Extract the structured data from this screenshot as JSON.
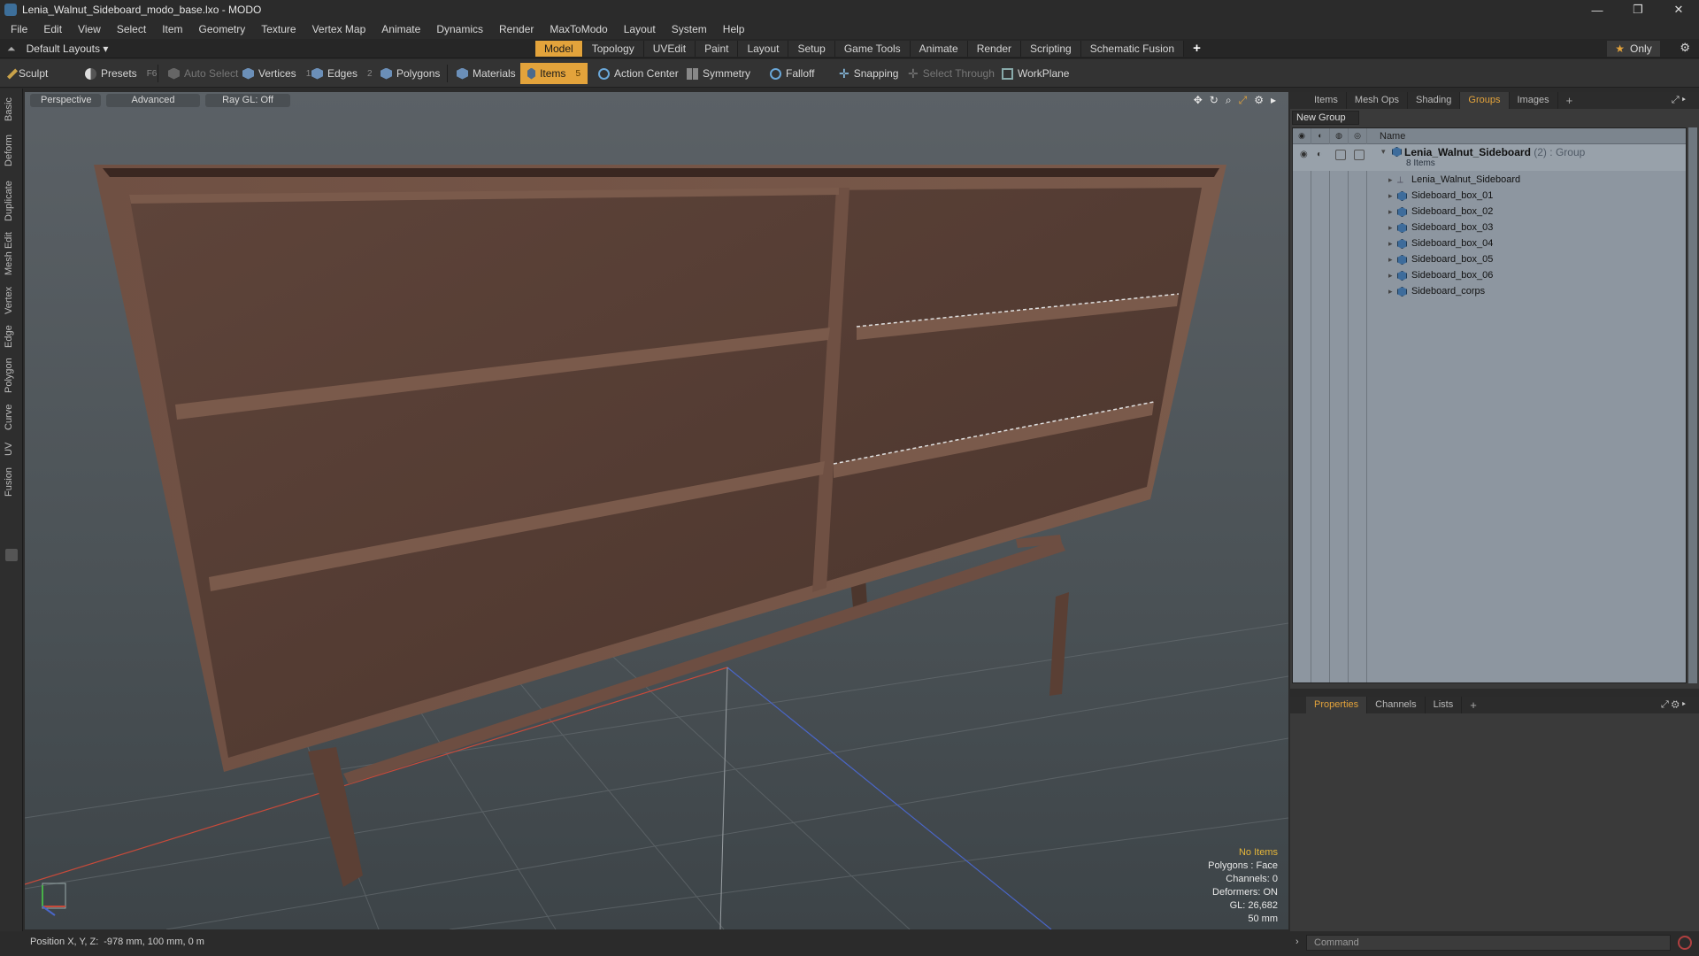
{
  "window": {
    "title": "Lenia_Walnut_Sideboard_modo_base.lxo - MODO",
    "minimize": "—",
    "restore": "❐",
    "close": "✕"
  },
  "menu": [
    "File",
    "Edit",
    "View",
    "Select",
    "Item",
    "Geometry",
    "Texture",
    "Vertex Map",
    "Animate",
    "Dynamics",
    "Render",
    "MaxToModo",
    "Layout",
    "System",
    "Help"
  ],
  "layouts": {
    "label": "Default Layouts ▾"
  },
  "mode_tabs": [
    "Model",
    "Topology",
    "UVEdit",
    "Paint",
    "Layout",
    "Setup",
    "Game Tools",
    "Animate",
    "Render",
    "Scripting",
    "Schematic Fusion"
  ],
  "mode_tabs_active": "Model",
  "only": {
    "label": "Only"
  },
  "toolbar": {
    "sculpt": "Sculpt",
    "presets": "Presets",
    "presets_key": "F6",
    "auto_select": "Auto Select",
    "vertices": "Vertices",
    "vertices_key": "1",
    "edges": "Edges",
    "edges_key": "2",
    "polygons": "Polygons",
    "materials": "Materials",
    "items": "Items",
    "items_key": "5",
    "action_center": "Action Center",
    "symmetry": "Symmetry",
    "falloff": "Falloff",
    "snapping": "Snapping",
    "select_through": "Select Through",
    "workplane": "WorkPlane"
  },
  "left_tabs": [
    "Basic",
    "Deform",
    "Duplicate",
    "Mesh Edit",
    "Vertex",
    "Edge",
    "Polygon",
    "Curve",
    "UV",
    "Fusion"
  ],
  "viewport": {
    "view": "Perspective",
    "shading": "Advanced",
    "raygl": "Ray GL: Off",
    "info": {
      "selection": "No Items",
      "polygons": "Polygons : Face",
      "channels": "Channels: 0",
      "deformers": "Deformers: ON",
      "gl": "GL: 26,682",
      "grid": "50 mm"
    }
  },
  "status": {
    "label": "Position X, Y, Z:",
    "value": "-978 mm, 100 mm, 0 m"
  },
  "groups_panel": {
    "tabs": [
      "Items",
      "Mesh Ops",
      "Shading",
      "Groups",
      "Images"
    ],
    "active": "Groups",
    "new_group": "New Group",
    "column_name": "Name",
    "group": {
      "name": "Lenia_Walnut_Sideboard",
      "count": "(2)",
      "type": ": Group",
      "sub": "8 Items"
    },
    "items": [
      "Lenia_Walnut_Sideboard",
      "Sideboard_box_01",
      "Sideboard_box_02",
      "Sideboard_box_03",
      "Sideboard_box_04",
      "Sideboard_box_05",
      "Sideboard_box_06",
      "Sideboard_corps"
    ]
  },
  "properties_panel": {
    "tabs": [
      "Properties",
      "Channels",
      "Lists"
    ],
    "active": "Properties"
  },
  "command": {
    "placeholder": "Command"
  },
  "colors": {
    "accent": "#e3a33b",
    "wood": "#5a4137",
    "viewport_bg": "#4f565b"
  }
}
